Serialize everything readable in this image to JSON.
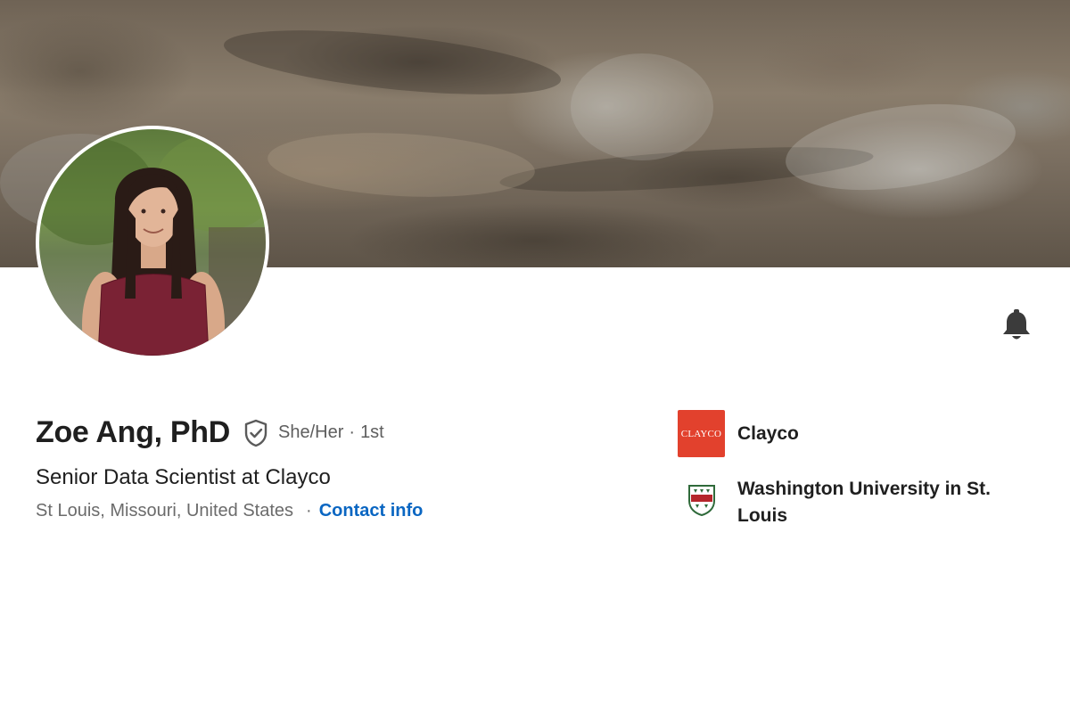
{
  "profile": {
    "name": "Zoe Ang, PhD",
    "pronouns": "She/Her",
    "separator": "·",
    "connection_degree": "1st",
    "headline": "Senior Data Scientist at Clayco",
    "location": "St Louis, Missouri, United States",
    "contact_separator": "·",
    "contact_label": "Contact info"
  },
  "organizations": [
    {
      "name": "Clayco",
      "logo_text": "CLAYCO",
      "logo_color": "#e2412d",
      "logo_icon": "clayco-logo"
    },
    {
      "name": "Washington University in St. Louis",
      "logo_icon": "wustl-shield-logo"
    }
  ],
  "icons": {
    "verified": "shield-check-icon",
    "notifications": "bell-icon"
  },
  "colors": {
    "link": "#0a66c2",
    "text_primary": "#1f1f1f",
    "text_secondary": "#5e5e5e"
  }
}
